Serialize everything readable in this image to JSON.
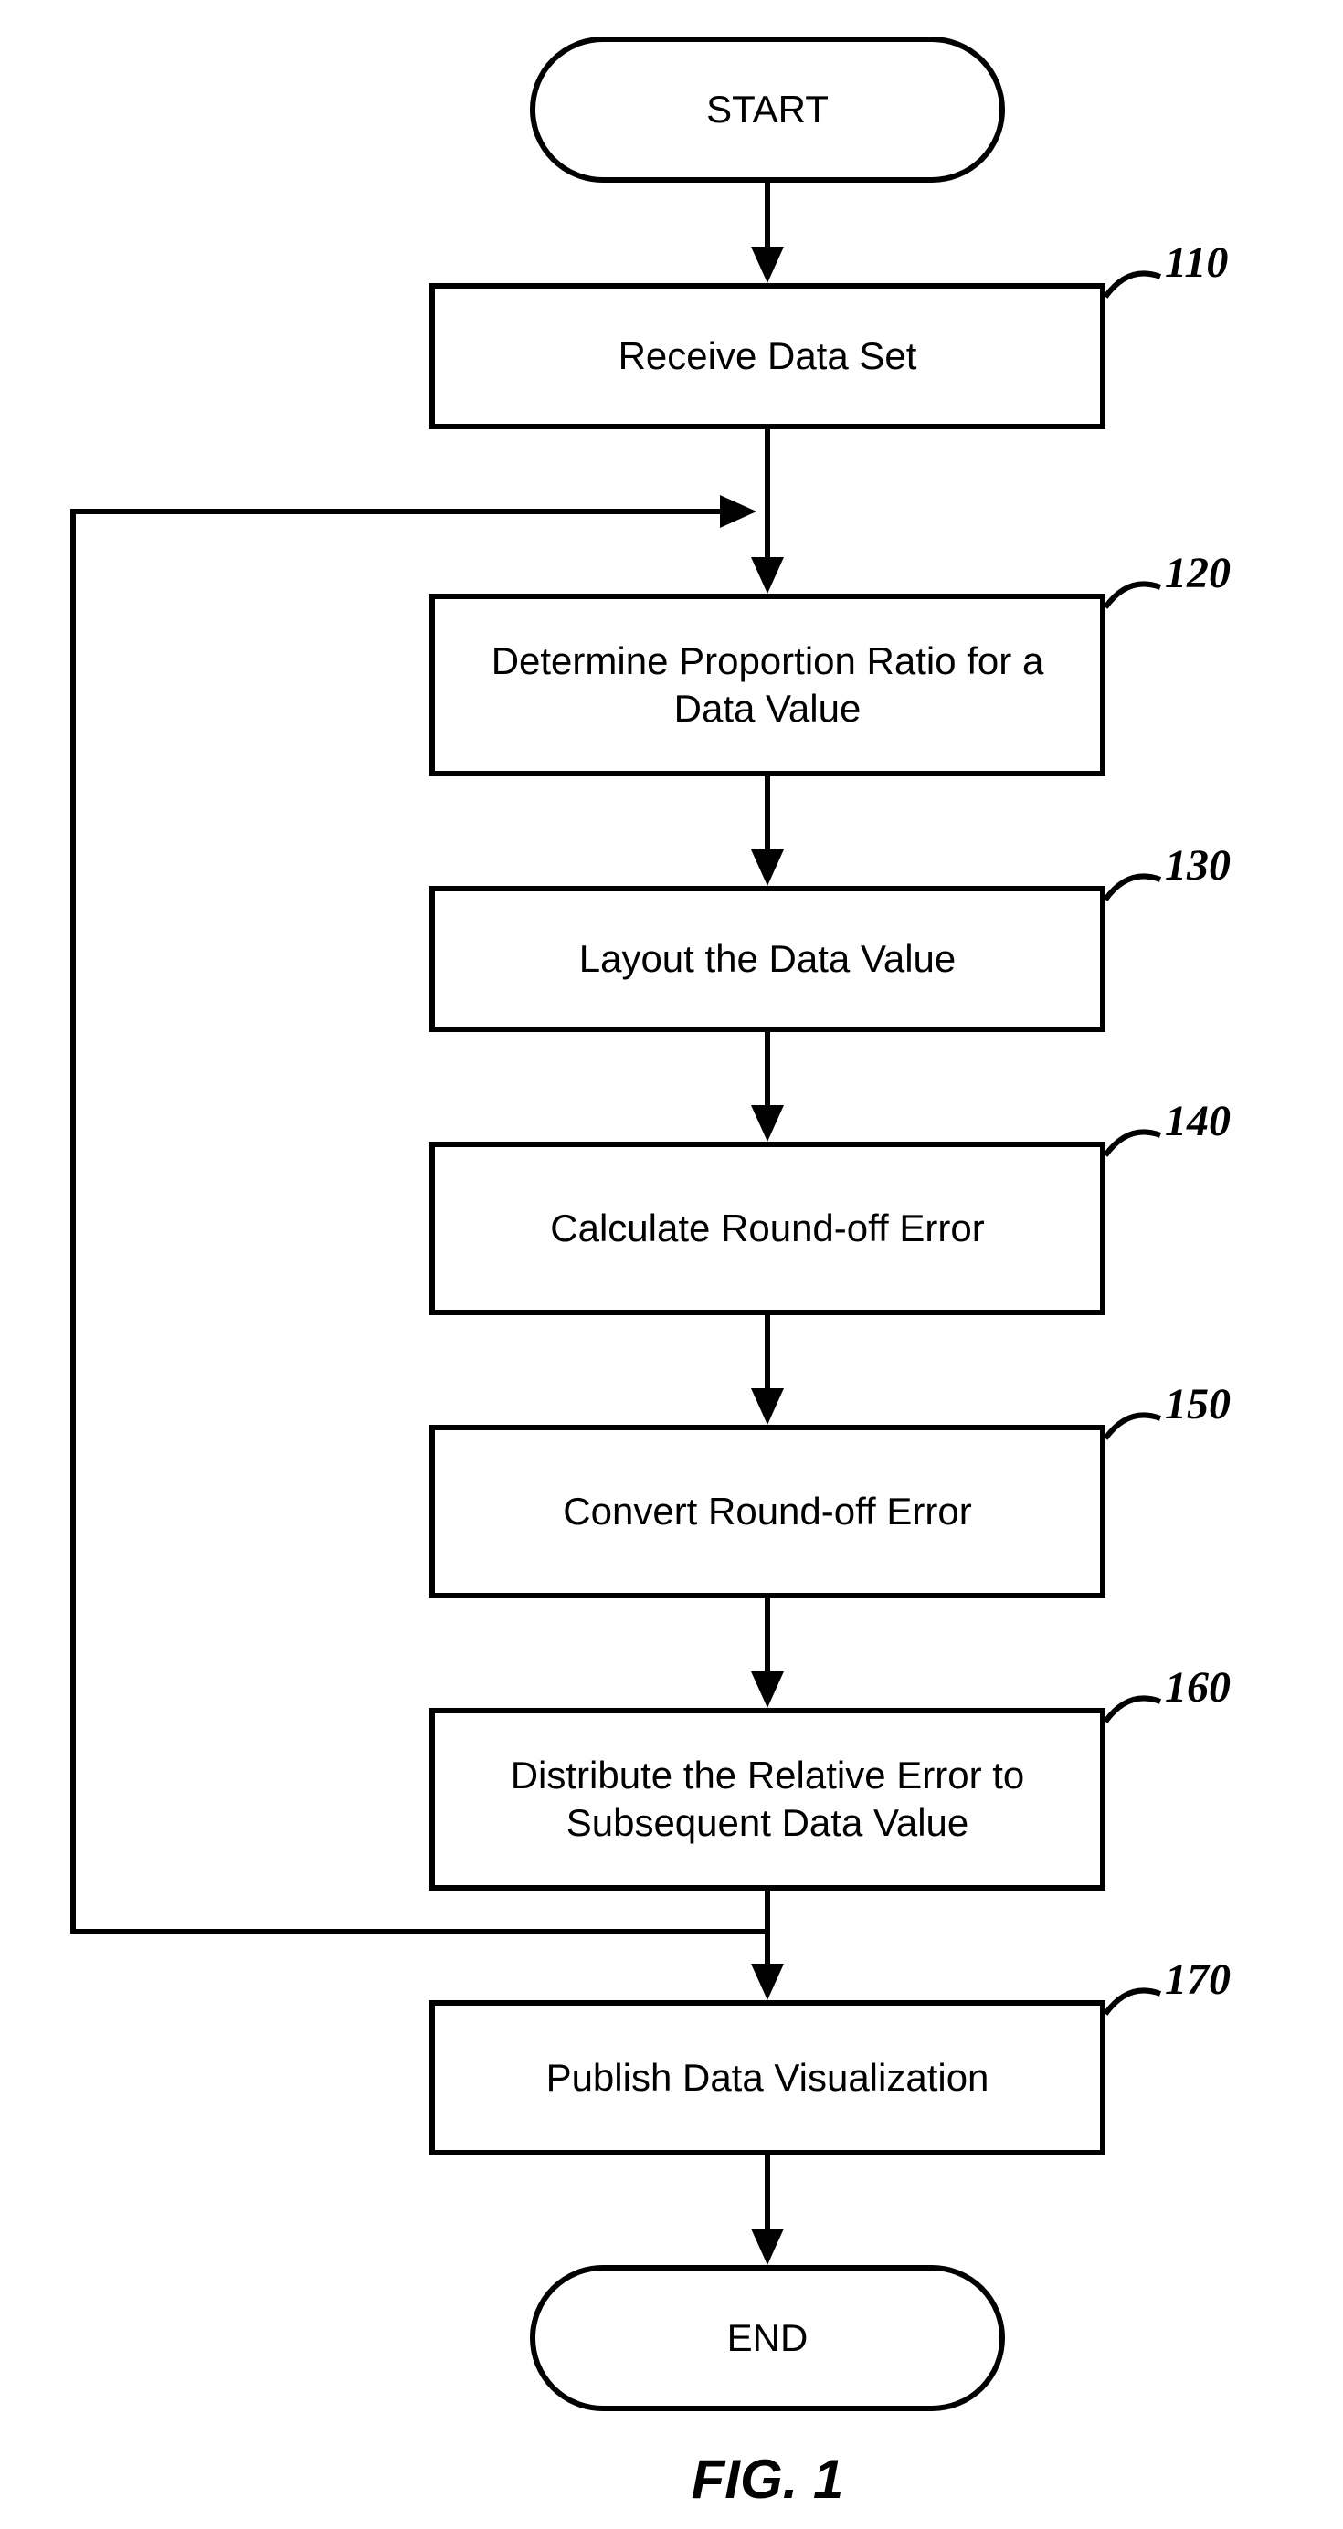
{
  "flow": {
    "start": {
      "label": "START"
    },
    "end": {
      "label": "END"
    },
    "steps": [
      {
        "id": "110",
        "label": "Receive Data Set",
        "ref": "110"
      },
      {
        "id": "120",
        "label": "Determine Proportion Ratio for a\nData Value",
        "ref": "120"
      },
      {
        "id": "130",
        "label": "Layout the Data Value",
        "ref": "130"
      },
      {
        "id": "140",
        "label": "Calculate Round-off Error",
        "ref": "140"
      },
      {
        "id": "150",
        "label": "Convert Round-off Error",
        "ref": "150"
      },
      {
        "id": "160",
        "label": "Distribute the Relative Error to\nSubsequent Data Value",
        "ref": "160"
      },
      {
        "id": "170",
        "label": "Publish Data Visualization",
        "ref": "170"
      }
    ],
    "caption": "FIG. 1"
  }
}
